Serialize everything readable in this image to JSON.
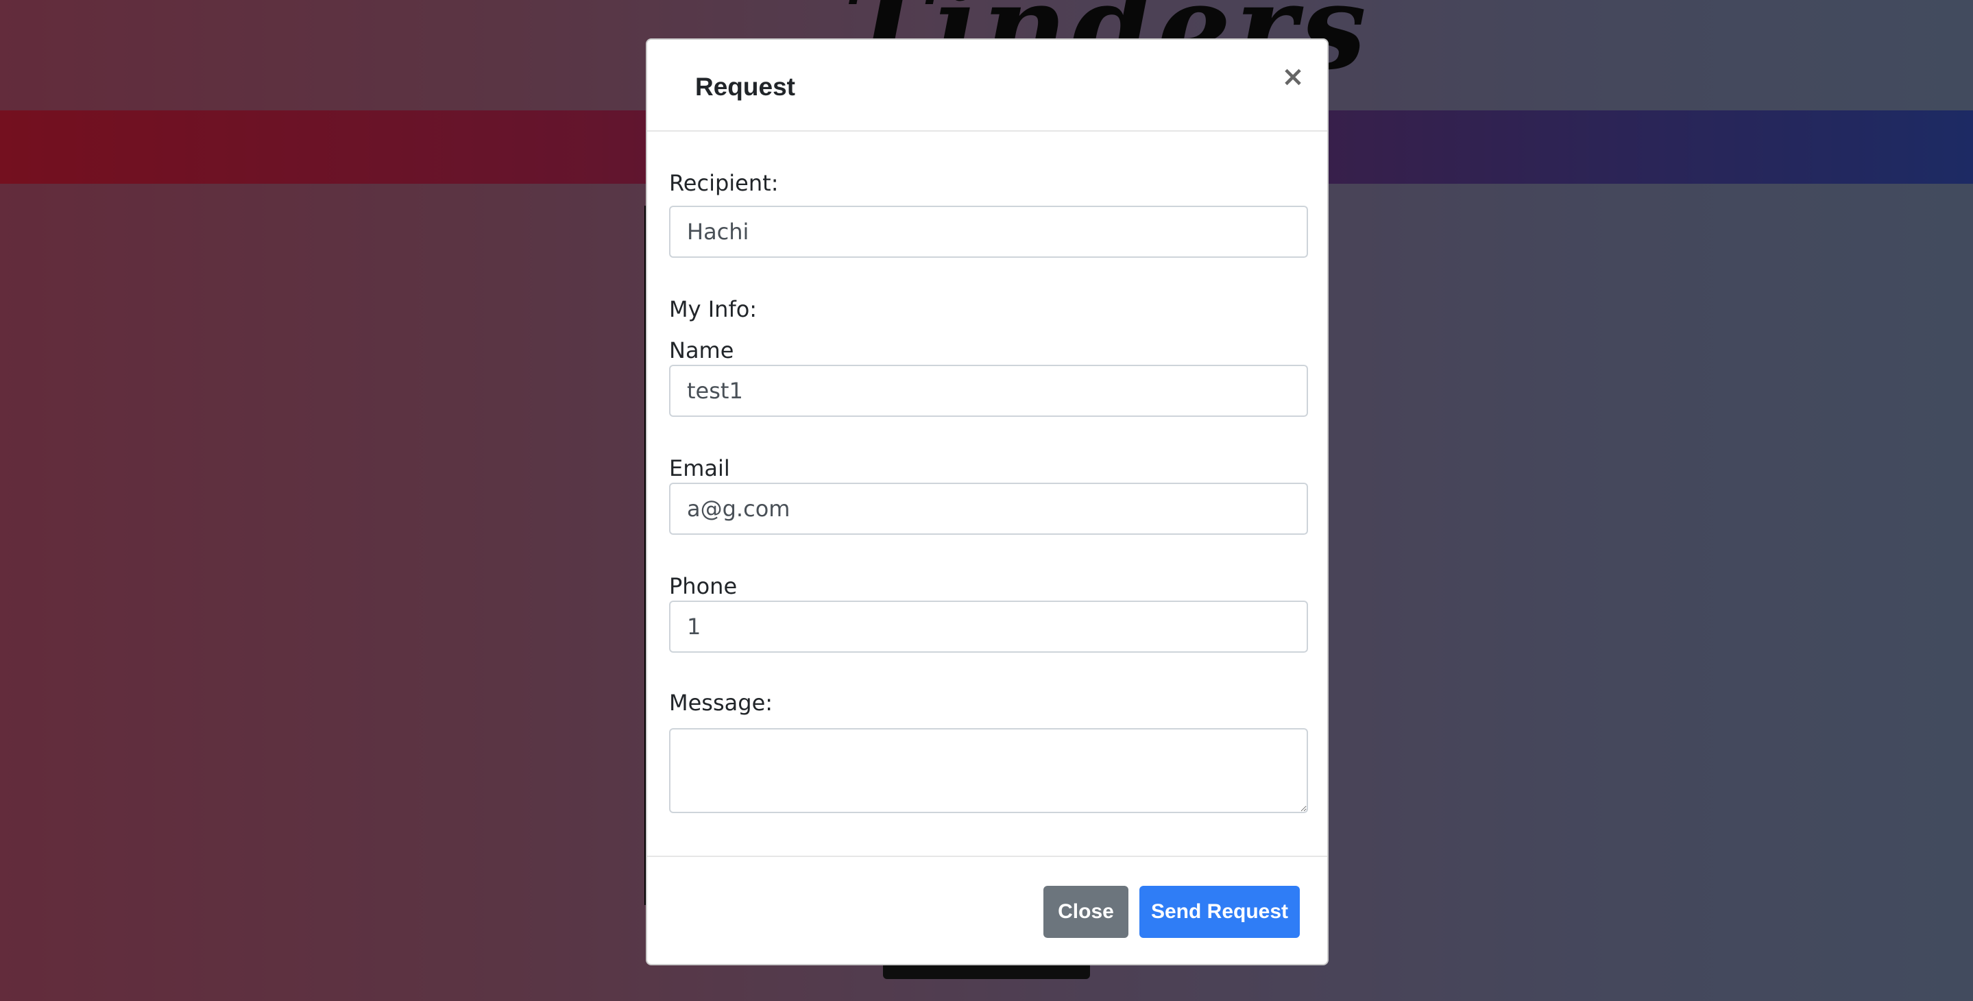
{
  "background": {
    "site_title": "Tinders"
  },
  "modal": {
    "title": "Request",
    "close_glyph": "×",
    "recipient": {
      "label": "Recipient:",
      "value": "Hachi"
    },
    "my_info_label": "My Info:",
    "name": {
      "label": "Name",
      "value": "test1"
    },
    "email": {
      "label": "Email",
      "value": "a@g.com"
    },
    "phone": {
      "label": "Phone",
      "value": "1"
    },
    "message": {
      "label": "Message:",
      "value": ""
    },
    "buttons": {
      "close_label": "Close",
      "send_label": "Send Request"
    }
  },
  "colors": {
    "primary": "#2f7df6",
    "secondary": "#6c757d"
  },
  "icons": {
    "close": "close-icon"
  }
}
